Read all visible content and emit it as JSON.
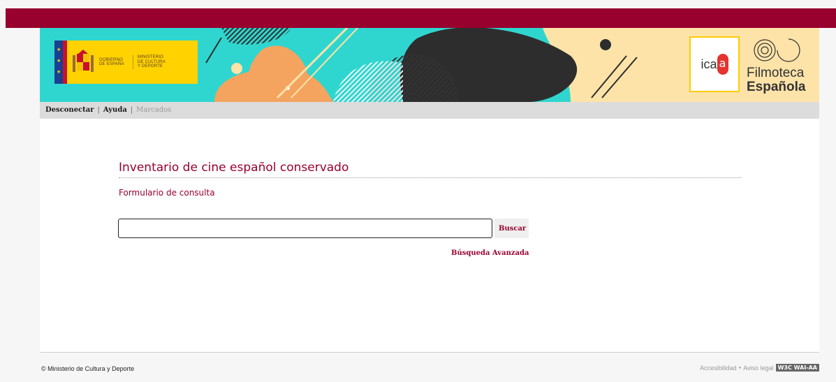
{
  "banner": {
    "gov_text_1": "GOBIERNO\nDE ESPAÑA",
    "gov_text_2": "MINISTERIO\nDE CULTURA\nY DEPORTE",
    "icaa_prefix": "ica",
    "icaa_suffix": "a",
    "filmoteca_line1": "Filmoteca",
    "filmoteca_line2": "Española"
  },
  "nav": {
    "items": [
      {
        "label": "Desconectar"
      },
      {
        "label": "Ayuda"
      },
      {
        "label": "Marcados"
      }
    ],
    "separator": "|"
  },
  "main": {
    "title": "Inventario de cine español conservado",
    "subtitle": "Formulario de consulta",
    "search": {
      "value": "",
      "placeholder": "",
      "button_label": "Buscar"
    },
    "advanced_link": "Búsqueda Avanzada"
  },
  "footer": {
    "copyright": "© Ministerio de Cultura y Deporte",
    "accessibility": "Accesibilidad",
    "bullet": "●",
    "legal": "Aviso legal",
    "badge": "W3C WAI-AA"
  },
  "colors": {
    "brand": "#98002e",
    "banner_teal": "#2fd6cf",
    "gov_yellow": "#ffd200"
  }
}
